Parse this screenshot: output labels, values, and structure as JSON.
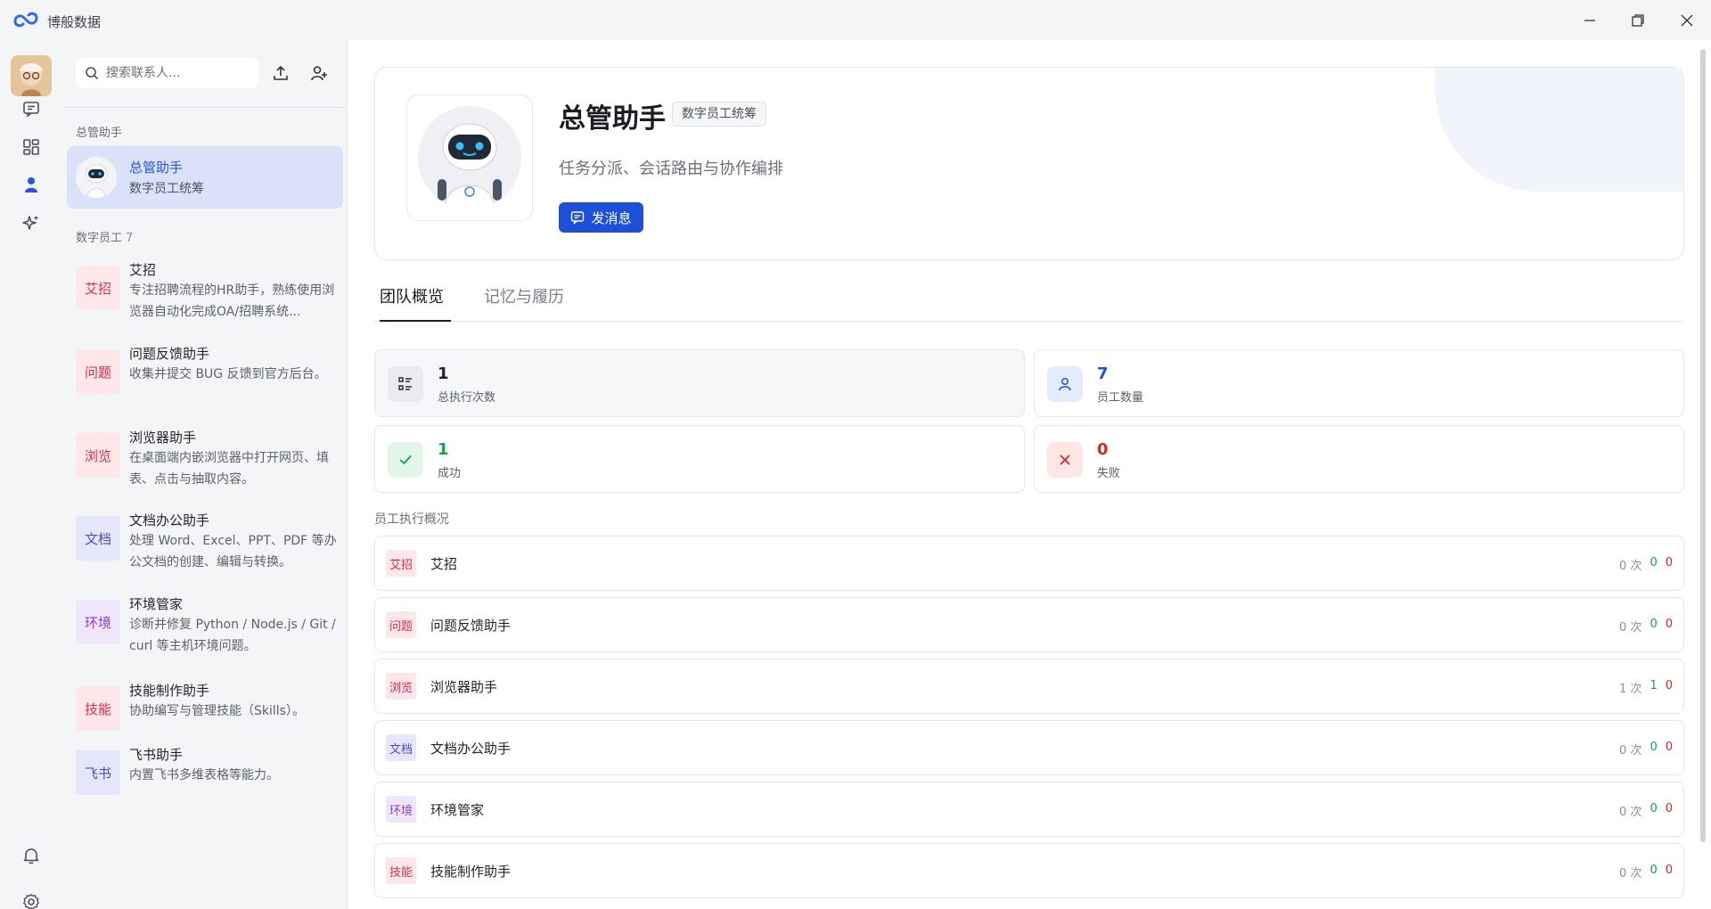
{
  "app": {
    "title": "博般数据"
  },
  "search": {
    "placeholder": "搜索联系人..."
  },
  "sections": {
    "manager_label": "总管助手",
    "employees_label": "数字员工",
    "employees_count": "7"
  },
  "manager": {
    "name": "总管助手",
    "subtitle": "数字员工统筹"
  },
  "employees": [
    {
      "tag": "艾招",
      "name": "艾招",
      "desc": "专注招聘流程的HR助手，熟练使用浏览器自动化完成OA/招聘系统...",
      "color": "pink"
    },
    {
      "tag": "问题",
      "name": "问题反馈助手",
      "desc": "收集并提交 BUG 反馈到官方后台。",
      "color": "pink"
    },
    {
      "tag": "浏览",
      "name": "浏览器助手",
      "desc": "在桌面端内嵌浏览器中打开网页、填表、点击与抽取内容。",
      "color": "pink"
    },
    {
      "tag": "文档",
      "name": "文档办公助手",
      "desc": "处理 Word、Excel、PPT、PDF 等办公文档的创建、编辑与转换。",
      "color": "indigo"
    },
    {
      "tag": "环境",
      "name": "环境管家",
      "desc": "诊断并修复 Python / Node.js / Git / curl 等主机环境问题。",
      "color": "purple"
    },
    {
      "tag": "技能",
      "name": "技能制作助手",
      "desc": "协助编写与管理技能（Skills）。",
      "color": "pink"
    },
    {
      "tag": "飞书",
      "name": "飞书助手",
      "desc": "内置飞书多维表格等能力。",
      "color": "indigo"
    }
  ],
  "profile": {
    "name": "总管助手",
    "badge": "数字员工统筹",
    "description": "任务分派、会话路由与协作编排",
    "send_label": "发消息"
  },
  "tabs": [
    {
      "label": "团队概览",
      "active": true
    },
    {
      "label": "记忆与履历",
      "active": false
    }
  ],
  "stats": {
    "total": {
      "value": "1",
      "label": "总执行次数",
      "color": "#1f2329"
    },
    "employees": {
      "value": "7",
      "label": "员工数量",
      "color": "#1d4fd8"
    },
    "success": {
      "value": "1",
      "label": "成功",
      "color": "#16a34a"
    },
    "failure": {
      "value": "0",
      "label": "失败",
      "color": "#dc2626"
    }
  },
  "exec_section_title": "员工执行概况",
  "exec_rows": [
    {
      "tag": "艾招",
      "name": "艾招",
      "count": "0 次",
      "ok": "0",
      "fail": "0",
      "color": "pink"
    },
    {
      "tag": "问题",
      "name": "问题反馈助手",
      "count": "0 次",
      "ok": "0",
      "fail": "0",
      "color": "pink"
    },
    {
      "tag": "浏览",
      "name": "浏览器助手",
      "count": "1 次",
      "ok": "1",
      "fail": "0",
      "color": "pink"
    },
    {
      "tag": "文档",
      "name": "文档办公助手",
      "count": "0 次",
      "ok": "0",
      "fail": "0",
      "color": "indigo"
    },
    {
      "tag": "环境",
      "name": "环境管家",
      "count": "0 次",
      "ok": "0",
      "fail": "0",
      "color": "purple"
    },
    {
      "tag": "技能",
      "name": "技能制作助手",
      "count": "0 次",
      "ok": "0",
      "fail": "0",
      "color": "pink"
    }
  ]
}
